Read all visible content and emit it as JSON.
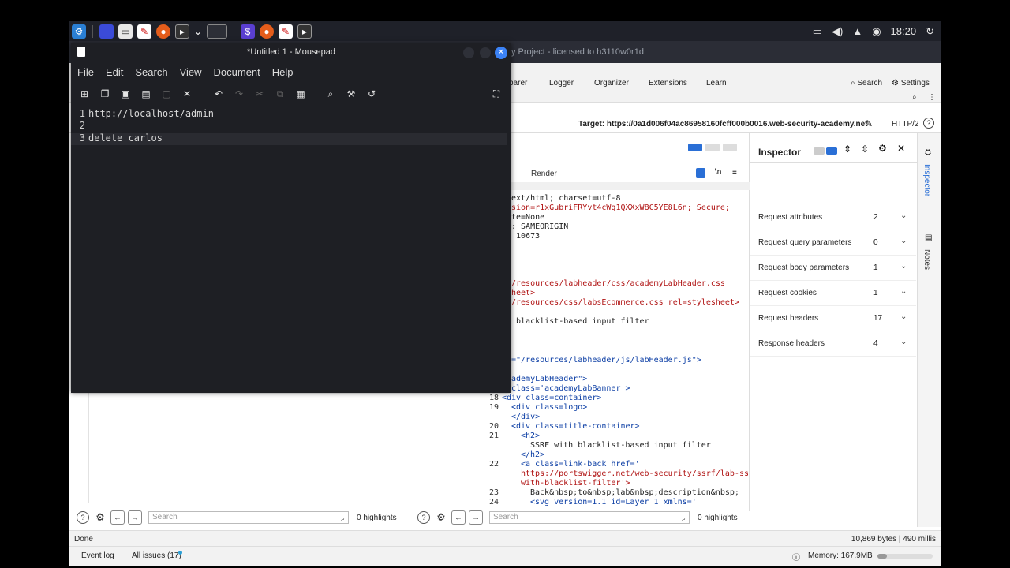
{
  "taskbar": {
    "clock": "18:20"
  },
  "burp": {
    "title": "y Project - licensed to h3110w0r1d",
    "nav": [
      "parer",
      "Logger",
      "Organizer",
      "Extensions",
      "Learn"
    ],
    "search_label": "Search",
    "settings_label": "Settings",
    "target_label": "Target: https://0a1d006f04ac86958160fcff000b0016.web-security-academy.net",
    "http_version": "HTTP/2",
    "render_tab": "Render",
    "response_lines": [
      {
        "text": "ext/html; charset=utf-8",
        "cls": ""
      },
      {
        "text": "sion=r1xGubriFRYvt4cWg1QXXxW8C5YE8L6n; Secure;",
        "cls": "str"
      },
      {
        "text": "te=None",
        "cls": ""
      },
      {
        "text": ": SAMEORIGIN",
        "cls": ""
      },
      {
        "text": " 10673",
        "cls": ""
      },
      {
        "text": "/resources/labheader/css/academyLabHeader.css",
        "cls": "str"
      },
      {
        "text": "heet>",
        "cls": "str"
      },
      {
        "text": "/resources/css/labsEcommerce.css rel=stylesheet>",
        "cls": "str"
      },
      {
        "text": " blacklist-based input filter",
        "cls": ""
      },
      {
        "text": "=\"/resources/labheader/js/labHeader.js\">",
        "cls": "tag"
      },
      {
        "text": "ademyLabHeader\">",
        "cls": "tag"
      },
      {
        "text": "class='academyLabBanner'>",
        "cls": "tag"
      },
      {
        "text": "<div class=container>",
        "cls": "tag"
      },
      {
        "text": "<div class=logo>",
        "cls": "tag"
      },
      {
        "text": "</div>",
        "cls": "tag"
      },
      {
        "text": "<div class=title-container>",
        "cls": "tag"
      },
      {
        "text": "<h2>",
        "cls": "tag"
      },
      {
        "text": "SSRF with blacklist-based input filter",
        "cls": ""
      },
      {
        "text": "</h2>",
        "cls": "tag"
      },
      {
        "text": "<a class=link-back href='",
        "cls": "tag"
      },
      {
        "text": "https://portswigger.net/web-security/ssrf/lab-ssrf-",
        "cls": "str"
      },
      {
        "text": "with-blacklist-filter'>",
        "cls": "str"
      },
      {
        "text": "Back&nbsp;to&nbsp;lab&nbsp;description&nbsp;",
        "cls": ""
      },
      {
        "text": "<svg version=1.1 id=Layer_1 xmlns='",
        "cls": "tag"
      }
    ],
    "line_numbers": [
      "18",
      "19",
      "20",
      "21",
      "22",
      "23",
      "24"
    ],
    "inspector": {
      "title": "Inspector",
      "rows": [
        {
          "label": "Request attributes",
          "count": "2"
        },
        {
          "label": "Request query parameters",
          "count": "0"
        },
        {
          "label": "Request body parameters",
          "count": "1"
        },
        {
          "label": "Request cookies",
          "count": "1"
        },
        {
          "label": "Request headers",
          "count": "17"
        },
        {
          "label": "Response headers",
          "count": "4"
        }
      ],
      "side_tabs": [
        "Inspector",
        "Notes"
      ]
    },
    "search": {
      "placeholder": "Search",
      "highlights_left": "0 highlights",
      "highlights_right": "0 highlights"
    },
    "status": {
      "done": "Done",
      "bytes": "10,869 bytes | 490 millis",
      "event_log": "Event log",
      "all_issues": "All issues (17)",
      "memory": "Memory: 167.9MB"
    }
  },
  "mousepad": {
    "title": "*Untitled 1 - Mousepad",
    "menu": [
      "File",
      "Edit",
      "Search",
      "View",
      "Document",
      "Help"
    ],
    "lines": [
      {
        "num": "1",
        "text": "http://localhost/admin"
      },
      {
        "num": "2",
        "text": ""
      },
      {
        "num": "3",
        "text": "delete carlos"
      }
    ]
  }
}
